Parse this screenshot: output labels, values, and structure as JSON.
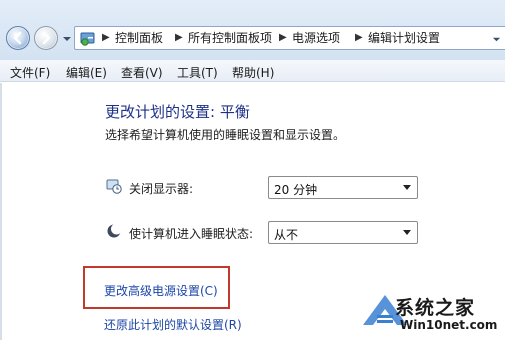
{
  "address_bar": {
    "breadcrumbs": [
      "控制面板",
      "所有控制面板项",
      "电源选项",
      "编辑计划设置"
    ]
  },
  "menu": {
    "items": [
      "文件(F)",
      "编辑(E)",
      "查看(V)",
      "工具(T)",
      "帮助(H)"
    ]
  },
  "main": {
    "title": "更改计划的设置: 平衡",
    "subtitle": "选择希望计算机使用的睡眠设置和显示设置。",
    "settings": [
      {
        "label": "关闭显示器:",
        "value": "20 分钟",
        "icon": "display-clock-icon"
      },
      {
        "label": "使计算机进入睡眠状态:",
        "value": "从不",
        "icon": "sleep-moon-icon"
      }
    ],
    "links": {
      "advanced": "更改高级电源设置(C)",
      "restore": "还原此计划的默认设置(R)"
    }
  },
  "watermark": {
    "name": "系统之家",
    "url": "Win10net.com"
  },
  "colors": {
    "title": "#1e3287",
    "link": "#1c46a8",
    "highlight": "#c0392b"
  }
}
